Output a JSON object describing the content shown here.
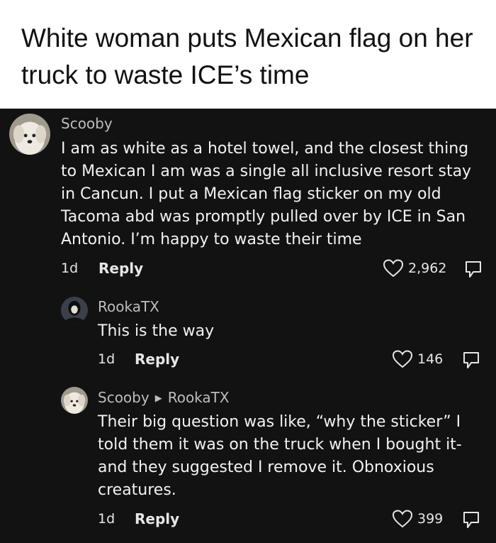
{
  "headline": "White woman puts Mexican flag on her truck to waste ICE’s time",
  "comments": [
    {
      "username": "Scooby",
      "reply_to": "",
      "text": "I am as white as a hotel towel, and the closest thing to Mexican I am was a single all inclusive resort stay in Cancun. I put a Mexican flag sticker on my old Tacoma abd was promptly pulled over by ICE in San Antonio. I’m happy to waste their time",
      "age": "1d",
      "reply_label": "Reply",
      "likes": "2,962",
      "avatar_icon": "dog-avatar"
    },
    {
      "username": "RookaTX",
      "reply_to": "",
      "text": "This is the way",
      "age": "1d",
      "reply_label": "Reply",
      "likes": "146",
      "avatar_icon": "person-avatar"
    },
    {
      "username": "Scooby",
      "reply_to": "RookaTX",
      "text": "Their big question was like, “why the sticker” I told them it was on the truck when I bought it- and they suggested I remove it. Obnoxious creatures.",
      "age": "1d",
      "reply_label": "Reply",
      "likes": "399",
      "avatar_icon": "dog-avatar"
    }
  ],
  "colors": {
    "background_top": "#ffffff",
    "thread_background": "#121212",
    "username": "#bdbdbd",
    "text": "#f2f2f2"
  }
}
